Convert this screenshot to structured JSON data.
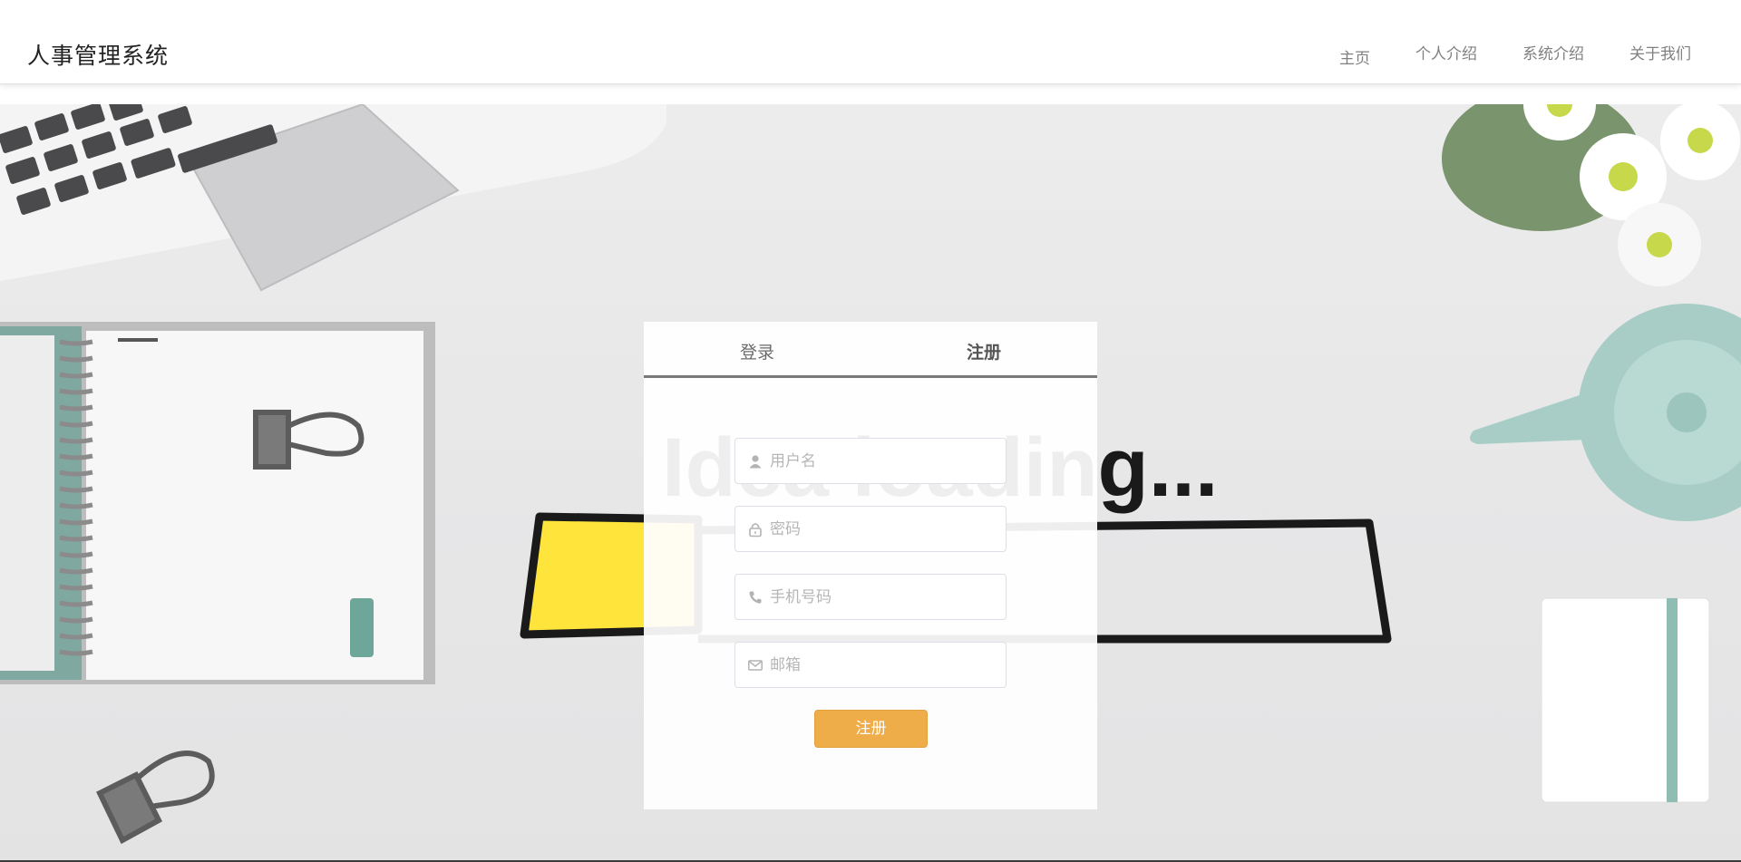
{
  "app": {
    "title": "人事管理系统"
  },
  "nav": {
    "items": [
      "主页",
      "个人介绍",
      "系统介绍",
      "关于我们"
    ]
  },
  "auth": {
    "tabs": [
      {
        "label": "登录"
      },
      {
        "label": "注册",
        "active": true
      }
    ],
    "fields": [
      {
        "placeholder": "用户名",
        "icon": "user-icon"
      },
      {
        "placeholder": "密码",
        "icon": "lock-icon"
      },
      {
        "placeholder": "手机号码",
        "icon": "phone-icon"
      },
      {
        "placeholder": "邮箱",
        "icon": "mail-icon"
      }
    ],
    "submit_label": "注册"
  },
  "background": {
    "headline": "Idea loading..."
  },
  "colors": {
    "accent": "#efad4a",
    "tab_border": "#7a7a7a",
    "highlight": "#ffe53b"
  }
}
